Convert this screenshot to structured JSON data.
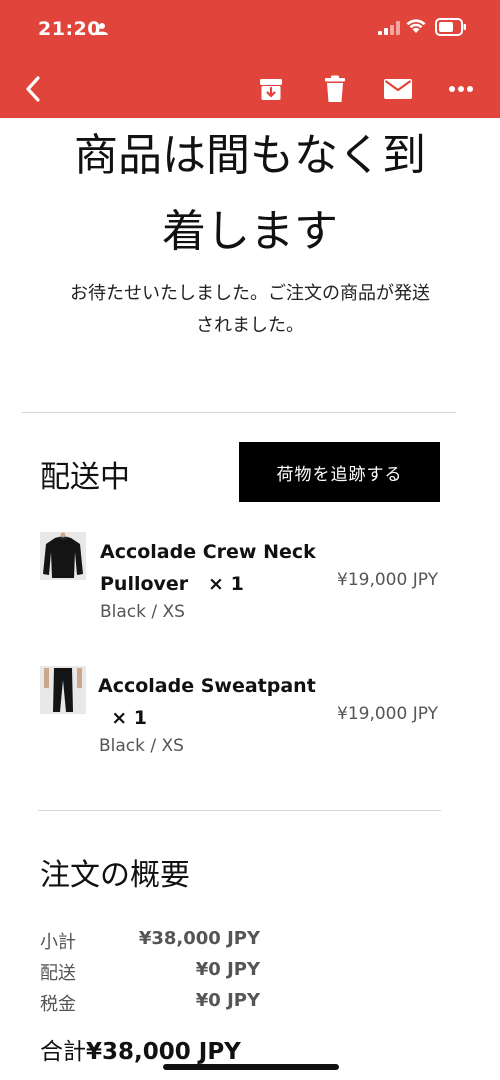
{
  "status_bar": {
    "time": "21:20"
  },
  "toolbar": {
    "icons": [
      "back-icon",
      "archive-icon",
      "trash-icon",
      "mail-icon",
      "more-icon"
    ],
    "accent_color": "#e0443a"
  },
  "headline": {
    "line1": "商品は間もなく到",
    "line2": "着します"
  },
  "intro": {
    "line1": "お待たせいたしました。ご注文の商品が発送",
    "line2": "されました。"
  },
  "shipping": {
    "title": "配送中",
    "track_button_label": "荷物を追跡する"
  },
  "items": [
    {
      "name_line1": "Accolade Crew Neck",
      "name_line2": "Pullover",
      "qty": "× 1",
      "price": "¥19,000 JPY",
      "variant": "Black / XS"
    },
    {
      "name_line1": "Accolade Sweatpant",
      "name_line2": "",
      "qty": "× 1",
      "price": "¥19,000 JPY",
      "variant": "Black / XS"
    }
  ],
  "summary": {
    "title": "注文の概要",
    "subtotal_label": "小計",
    "subtotal_value": "¥38,000 JPY",
    "shipping_label": "配送",
    "shipping_value": "¥0 JPY",
    "tax_label": "税金",
    "tax_value": "¥0 JPY",
    "total_label": "合計",
    "total_value": "¥38,000 JPY"
  }
}
